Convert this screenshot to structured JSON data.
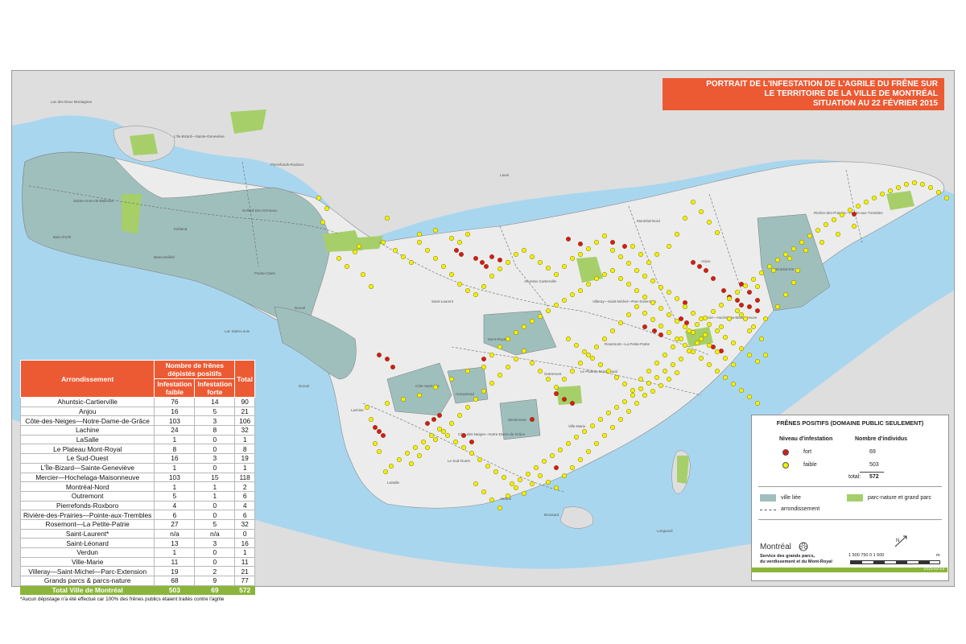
{
  "title": {
    "line1": "PORTRAIT DE L'INFESTATION DE L'AGRILE DU FRÊNE SUR",
    "line2": "LE TERRITOIRE DE LA  VILLE DE MONTRÉAL",
    "line3": "SITUATION AU 22 FÉVRIER 2015"
  },
  "table": {
    "header_col1": "Arrondissement",
    "header_group": "Nombre de frênes dépistés positifs",
    "header_faible": "Infestation faible",
    "header_forte": "Infestation forte",
    "header_total": "Total",
    "rows": [
      {
        "name": "Ahuntsic-Cartierville",
        "faible": "76",
        "forte": "14",
        "total": "90"
      },
      {
        "name": "Anjou",
        "faible": "16",
        "forte": "5",
        "total": "21"
      },
      {
        "name": "Côte-des-Neiges—Notre-Dame-de-Grâce",
        "faible": "103",
        "forte": "3",
        "total": "106"
      },
      {
        "name": "Lachine",
        "faible": "24",
        "forte": "8",
        "total": "32"
      },
      {
        "name": "LaSalle",
        "faible": "1",
        "forte": "0",
        "total": "1"
      },
      {
        "name": "Le Plateau Mont-Royal",
        "faible": "8",
        "forte": "0",
        "total": "8"
      },
      {
        "name": "Le Sud-Ouest",
        "faible": "16",
        "forte": "3",
        "total": "19"
      },
      {
        "name": "L'Île-Bizard—Sainte-Geneviève",
        "faible": "1",
        "forte": "0",
        "total": "1"
      },
      {
        "name": "Mercier—Hochelaga-Maisonneuve",
        "faible": "103",
        "forte": "15",
        "total": "118"
      },
      {
        "name": "Montréal-Nord",
        "faible": "1",
        "forte": "1",
        "total": "2"
      },
      {
        "name": "Outremont",
        "faible": "5",
        "forte": "1",
        "total": "6"
      },
      {
        "name": "Pierrefonds-Roxboro",
        "faible": "4",
        "forte": "0",
        "total": "4"
      },
      {
        "name": "Rivière-des-Prairies—Pointe-aux-Trembles",
        "faible": "6",
        "forte": "0",
        "total": "6"
      },
      {
        "name": "Rosemont—La Petite-Patrie",
        "faible": "27",
        "forte": "5",
        "total": "32"
      },
      {
        "name": "Saint-Laurent*",
        "faible": "n/a",
        "forte": "n/a",
        "total": "0"
      },
      {
        "name": "Saint-Léonard",
        "faible": "13",
        "forte": "3",
        "total": "16"
      },
      {
        "name": "Verdun",
        "faible": "1",
        "forte": "0",
        "total": "1"
      },
      {
        "name": "Ville-Marie",
        "faible": "11",
        "forte": "0",
        "total": "11"
      },
      {
        "name": "Villeray—Saint-Michel—Parc-Extension",
        "faible": "19",
        "forte": "2",
        "total": "21"
      },
      {
        "name": "Grands parcs & parcs-nature",
        "faible": "68",
        "forte": "9",
        "total": "77"
      }
    ],
    "total_row": {
      "name": "Total Ville de Montréal",
      "faible": "503",
      "forte": "69",
      "total": "572"
    },
    "footnote": "*Aucun dépistage n'a été effectué car 100% des frênes publics étaient traités contre l'agrile"
  },
  "legend": {
    "title": "FRÊNES POSITIFS (DOMAINE PUBLIC SEULEMENT)",
    "col_level": "Niveau d'infestation",
    "col_count": "Nombre d'individus",
    "fort_label": "fort",
    "fort_count": "69",
    "faible_label": "faible",
    "faible_count": "503",
    "total_label": "total:",
    "total_count": "572",
    "ville_liee": "ville liée",
    "parc": "parc-nature et grand parc",
    "arrondissement": "arrondissement",
    "logo_text": "Montréal",
    "service_line1": "Service des grands parcs,",
    "service_line2": "du verdissement et du Mont-Royal",
    "scale_label": "1 500  750      0                1 500",
    "scale_unit": "m",
    "date": "2015-02-19",
    "colors": {
      "fort": "#d7191c",
      "faible": "#f4f000",
      "ville_liee": "#9fbfbd",
      "parc": "#a6cf6a"
    }
  },
  "map_colors": {
    "water": "#a9d6ef",
    "land": "#dedede",
    "montreal": "#ececec",
    "ville_liee": "#9fbfbd",
    "parc": "#a6cf6a"
  },
  "points_fort": [
    [
      590,
      320
    ],
    [
      598,
      325
    ],
    [
      603,
      330
    ],
    [
      610,
      318
    ],
    [
      620,
      322
    ],
    [
      566,
      310
    ],
    [
      572,
      315
    ],
    [
      760,
      300
    ],
    [
      775,
      305
    ],
    [
      720,
      302
    ],
    [
      705,
      296
    ],
    [
      860,
      325
    ],
    [
      868,
      330
    ],
    [
      876,
      335
    ],
    [
      885,
      345
    ],
    [
      898,
      360
    ],
    [
      905,
      368
    ],
    [
      915,
      372
    ],
    [
      920,
      378
    ],
    [
      930,
      380
    ],
    [
      940,
      372
    ],
    [
      845,
      395
    ],
    [
      852,
      400
    ],
    [
      800,
      405
    ],
    [
      812,
      410
    ],
    [
      820,
      415
    ],
    [
      885,
      430
    ],
    [
      895,
      435
    ],
    [
      470,
      440
    ],
    [
      480,
      445
    ],
    [
      487,
      455
    ],
    [
      465,
      530
    ],
    [
      470,
      535
    ],
    [
      475,
      540
    ],
    [
      530,
      525
    ],
    [
      538,
      520
    ],
    [
      545,
      515
    ],
    [
      1200,
      265
    ],
    [
      1060,
      265
    ],
    [
      920,
      352
    ],
    [
      930,
      362
    ],
    [
      940,
      385
    ],
    [
      850,
      375
    ],
    [
      690,
      488
    ],
    [
      700,
      495
    ],
    [
      710,
      500
    ],
    [
      660,
      520
    ],
    [
      600,
      445
    ],
    [
      575,
      540
    ],
    [
      585,
      548
    ],
    [
      690,
      580
    ]
  ],
  "points_faible": [
    [
      420,
      320
    ],
    [
      430,
      330
    ],
    [
      440,
      312
    ],
    [
      445,
      305
    ],
    [
      450,
      340
    ],
    [
      460,
      355
    ],
    [
      475,
      300
    ],
    [
      490,
      310
    ],
    [
      500,
      318
    ],
    [
      510,
      325
    ],
    [
      520,
      300
    ],
    [
      530,
      310
    ],
    [
      540,
      320
    ],
    [
      550,
      330
    ],
    [
      560,
      340
    ],
    [
      570,
      352
    ],
    [
      580,
      360
    ],
    [
      590,
      365
    ],
    [
      600,
      355
    ],
    [
      610,
      342
    ],
    [
      620,
      333
    ],
    [
      630,
      325
    ],
    [
      640,
      315
    ],
    [
      650,
      310
    ],
    [
      660,
      318
    ],
    [
      670,
      325
    ],
    [
      680,
      332
    ],
    [
      690,
      340
    ],
    [
      700,
      330
    ],
    [
      710,
      320
    ],
    [
      720,
      315
    ],
    [
      730,
      308
    ],
    [
      740,
      300
    ],
    [
      750,
      292
    ],
    [
      760,
      310
    ],
    [
      770,
      318
    ],
    [
      780,
      326
    ],
    [
      790,
      335
    ],
    [
      800,
      342
    ],
    [
      810,
      348
    ],
    [
      820,
      356
    ],
    [
      830,
      362
    ],
    [
      840,
      370
    ],
    [
      850,
      380
    ],
    [
      860,
      388
    ],
    [
      870,
      395
    ],
    [
      880,
      402
    ],
    [
      890,
      410
    ],
    [
      900,
      418
    ],
    [
      910,
      425
    ],
    [
      920,
      432
    ],
    [
      930,
      440
    ],
    [
      940,
      448
    ],
    [
      950,
      440
    ],
    [
      945,
      420
    ],
    [
      935,
      405
    ],
    [
      925,
      395
    ],
    [
      915,
      385
    ],
    [
      905,
      395
    ],
    [
      895,
      405
    ],
    [
      875,
      415
    ],
    [
      865,
      425
    ],
    [
      855,
      435
    ],
    [
      845,
      445
    ],
    [
      835,
      452
    ],
    [
      825,
      460
    ],
    [
      815,
      468
    ],
    [
      805,
      475
    ],
    [
      795,
      482
    ],
    [
      785,
      490
    ],
    [
      775,
      498
    ],
    [
      765,
      505
    ],
    [
      755,
      512
    ],
    [
      745,
      520
    ],
    [
      735,
      528
    ],
    [
      725,
      535
    ],
    [
      715,
      542
    ],
    [
      705,
      550
    ],
    [
      695,
      558
    ],
    [
      685,
      565
    ],
    [
      675,
      572
    ],
    [
      665,
      580
    ],
    [
      655,
      588
    ],
    [
      645,
      595
    ],
    [
      635,
      600
    ],
    [
      625,
      592
    ],
    [
      615,
      585
    ],
    [
      605,
      578
    ],
    [
      595,
      570
    ],
    [
      585,
      562
    ],
    [
      575,
      555
    ],
    [
      565,
      548
    ],
    [
      555,
      540
    ],
    [
      545,
      532
    ],
    [
      535,
      540
    ],
    [
      525,
      548
    ],
    [
      515,
      555
    ],
    [
      505,
      562
    ],
    [
      495,
      570
    ],
    [
      485,
      578
    ],
    [
      478,
      585
    ],
    [
      470,
      560
    ],
    [
      465,
      550
    ],
    [
      460,
      520
    ],
    [
      455,
      505
    ],
    [
      480,
      500
    ],
    [
      500,
      495
    ],
    [
      520,
      490
    ],
    [
      540,
      480
    ],
    [
      560,
      470
    ],
    [
      580,
      460
    ],
    [
      600,
      455
    ],
    [
      610,
      440
    ],
    [
      620,
      430
    ],
    [
      630,
      420
    ],
    [
      640,
      412
    ],
    [
      650,
      405
    ],
    [
      660,
      398
    ],
    [
      670,
      392
    ],
    [
      680,
      385
    ],
    [
      690,
      378
    ],
    [
      700,
      372
    ],
    [
      710,
      365
    ],
    [
      720,
      360
    ],
    [
      730,
      352
    ],
    [
      740,
      345
    ],
    [
      750,
      340
    ],
    [
      760,
      335
    ],
    [
      770,
      345
    ],
    [
      780,
      352
    ],
    [
      790,
      360
    ],
    [
      800,
      368
    ],
    [
      810,
      375
    ],
    [
      820,
      382
    ],
    [
      830,
      390
    ],
    [
      840,
      398
    ],
    [
      850,
      405
    ],
    [
      860,
      412
    ],
    [
      870,
      420
    ],
    [
      880,
      428
    ],
    [
      890,
      436
    ],
    [
      900,
      444
    ],
    [
      910,
      452
    ],
    [
      705,
      420
    ],
    [
      715,
      428
    ],
    [
      725,
      436
    ],
    [
      735,
      444
    ],
    [
      745,
      452
    ],
    [
      755,
      460
    ],
    [
      765,
      468
    ],
    [
      775,
      476
    ],
    [
      785,
      484
    ],
    [
      795,
      470
    ],
    [
      805,
      460
    ],
    [
      815,
      450
    ],
    [
      825,
      440
    ],
    [
      835,
      430
    ],
    [
      845,
      420
    ],
    [
      855,
      410
    ],
    [
      865,
      402
    ],
    [
      875,
      394
    ],
    [
      885,
      386
    ],
    [
      895,
      378
    ],
    [
      905,
      370
    ],
    [
      915,
      362
    ],
    [
      925,
      354
    ],
    [
      935,
      346
    ],
    [
      945,
      338
    ],
    [
      955,
      330
    ],
    [
      965,
      322
    ],
    [
      975,
      315
    ],
    [
      985,
      308
    ],
    [
      995,
      300
    ],
    [
      1005,
      292
    ],
    [
      1015,
      285
    ],
    [
      1025,
      278
    ],
    [
      1035,
      272
    ],
    [
      1045,
      266
    ],
    [
      1055,
      260
    ],
    [
      1065,
      255
    ],
    [
      1075,
      250
    ],
    [
      1085,
      245
    ],
    [
      1095,
      240
    ],
    [
      1105,
      236
    ],
    [
      1115,
      232
    ],
    [
      1125,
      228
    ],
    [
      1135,
      226
    ],
    [
      1145,
      228
    ],
    [
      1155,
      232
    ],
    [
      1165,
      238
    ],
    [
      1175,
      245
    ],
    [
      1060,
      280
    ],
    [
      1040,
      290
    ],
    [
      1020,
      300
    ],
    [
      1000,
      310
    ],
    [
      980,
      320
    ],
    [
      960,
      335
    ],
    [
      940,
      355
    ],
    [
      920,
      390
    ],
    [
      930,
      410
    ],
    [
      950,
      395
    ],
    [
      965,
      380
    ],
    [
      975,
      365
    ],
    [
      985,
      350
    ],
    [
      990,
      335
    ],
    [
      860,
      250
    ],
    [
      870,
      262
    ],
    [
      880,
      275
    ],
    [
      890,
      288
    ],
    [
      850,
      270
    ],
    [
      840,
      290
    ],
    [
      830,
      305
    ],
    [
      815,
      315
    ],
    [
      805,
      325
    ],
    [
      795,
      315
    ],
    [
      785,
      305
    ],
    [
      650,
      435
    ],
    [
      640,
      445
    ],
    [
      630,
      455
    ],
    [
      620,
      465
    ],
    [
      610,
      475
    ],
    [
      600,
      485
    ],
    [
      590,
      495
    ],
    [
      580,
      505
    ],
    [
      570,
      515
    ],
    [
      560,
      525
    ],
    [
      550,
      535
    ],
    [
      540,
      545
    ],
    [
      530,
      555
    ],
    [
      520,
      565
    ],
    [
      510,
      575
    ],
    [
      660,
      450
    ],
    [
      670,
      460
    ],
    [
      680,
      470
    ],
    [
      690,
      480
    ],
    [
      700,
      470
    ],
    [
      710,
      460
    ],
    [
      720,
      450
    ],
    [
      730,
      440
    ],
    [
      740,
      430
    ],
    [
      750,
      420
    ],
    [
      760,
      410
    ],
    [
      770,
      400
    ],
    [
      780,
      390
    ],
    [
      790,
      380
    ],
    [
      800,
      388
    ],
    [
      810,
      396
    ],
    [
      820,
      404
    ],
    [
      830,
      412
    ],
    [
      840,
      420
    ],
    [
      850,
      428
    ],
    [
      860,
      436
    ],
    [
      870,
      444
    ],
    [
      880,
      452
    ],
    [
      890,
      460
    ],
    [
      900,
      468
    ],
    [
      910,
      476
    ],
    [
      920,
      484
    ],
    [
      930,
      492
    ],
    [
      940,
      500
    ],
    [
      590,
      600
    ],
    [
      600,
      610
    ],
    [
      610,
      620
    ],
    [
      620,
      630
    ],
    [
      630,
      615
    ],
    [
      640,
      605
    ],
    [
      650,
      612
    ],
    [
      660,
      600
    ],
    [
      670,
      590
    ],
    [
      680,
      598
    ],
    [
      690,
      605
    ],
    [
      700,
      590
    ],
    [
      710,
      580
    ],
    [
      720,
      570
    ],
    [
      730,
      560
    ],
    [
      740,
      550
    ],
    [
      750,
      540
    ],
    [
      760,
      530
    ],
    [
      770,
      520
    ],
    [
      780,
      510
    ],
    [
      790,
      500
    ],
    [
      800,
      490
    ],
    [
      810,
      485
    ],
    [
      820,
      478
    ],
    [
      830,
      470
    ],
    [
      840,
      462
    ],
    [
      395,
      245
    ],
    [
      405,
      258
    ],
    [
      400,
      275
    ],
    [
      480,
      270
    ],
    [
      520,
      290
    ],
    [
      540,
      285
    ],
    [
      560,
      295
    ],
    [
      570,
      300
    ],
    [
      580,
      290
    ]
  ]
}
